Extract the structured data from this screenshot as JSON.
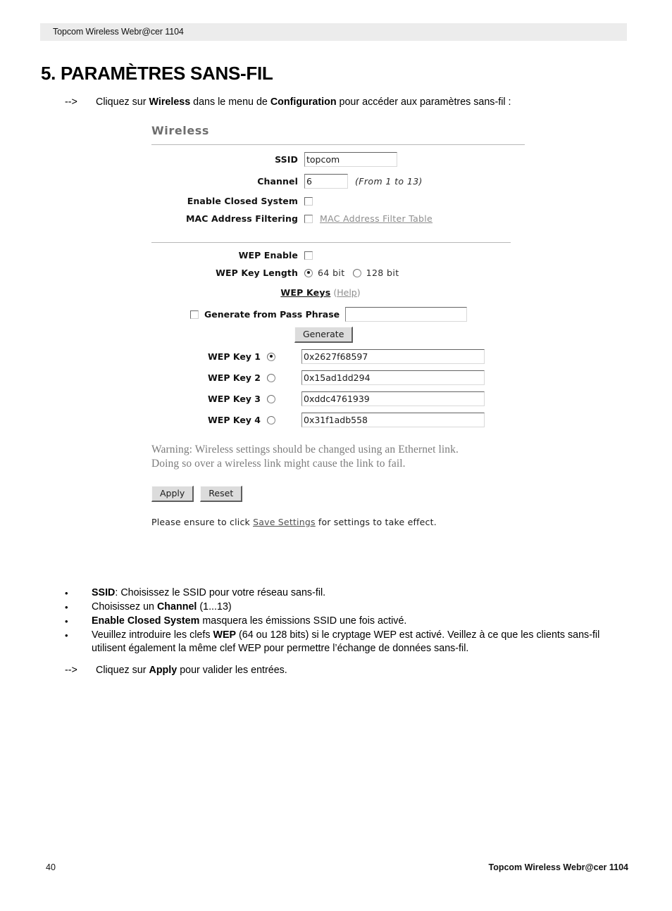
{
  "page": {
    "running_header": "Topcom Wireless Webr@cer 1104",
    "chapter_title": "5. PARAMÈTRES SANS-FIL",
    "footer_page_number": "40",
    "footer_right": "Topcom Wireless Webr@cer 1104"
  },
  "intro": {
    "arrow": "-->",
    "part1": "Cliquez sur ",
    "bold1": "Wireless",
    "part2": " dans le menu de ",
    "bold2": "Configuration",
    "part3": " pour accéder aux paramètres sans-fil :"
  },
  "router_ui": {
    "panel_title": "Wireless",
    "ssid": {
      "label": "SSID",
      "value": "topcom"
    },
    "channel": {
      "label": "Channel",
      "value": "6",
      "hint": "(From 1 to 13)"
    },
    "closed_system": {
      "label": "Enable Closed System",
      "checked": false
    },
    "mac_filtering": {
      "label": "MAC Address Filtering",
      "checked": false,
      "link": "MAC Address Filter Table"
    },
    "wep_enable": {
      "label": "WEP Enable",
      "checked": false
    },
    "wep_key_length": {
      "label": "WEP Key Length",
      "options": [
        {
          "label": "64 bit",
          "selected": true
        },
        {
          "label": "128 bit",
          "selected": false
        }
      ]
    },
    "wep_keys_heading": {
      "title": "WEP Keys",
      "help_open": "(",
      "help": "Help",
      "help_close": ")"
    },
    "pass_phrase": {
      "label": "Generate from Pass Phrase",
      "checked": false,
      "value": "",
      "placeholder": ""
    },
    "generate_button": "Generate",
    "wep_keys": [
      {
        "label": "WEP Key 1",
        "value": "0x2627f68597",
        "selected": true
      },
      {
        "label": "WEP Key 2",
        "value": "0x15ad1dd294",
        "selected": false
      },
      {
        "label": "WEP Key 3",
        "value": "0xddc4761939",
        "selected": false
      },
      {
        "label": "WEP Key 4",
        "value": "0x31f1adb558",
        "selected": false
      }
    ],
    "warning_line1": "Warning: Wireless settings should be changed using an Ethernet link.",
    "warning_line2": "Doing so over a wireless link might cause the link to fail.",
    "apply_button": "Apply",
    "reset_button": "Reset",
    "save_note": {
      "before": "Please ensure to click ",
      "link": "Save Settings",
      "after": " for settings to take effect."
    }
  },
  "bullets": [
    {
      "marker": "•",
      "segments": [
        {
          "text": "SSID",
          "bold": true
        },
        {
          "text": ": Choisissez le SSID pour votre réseau sans-fil.",
          "bold": false
        }
      ]
    },
    {
      "marker": "•",
      "segments": [
        {
          "text": "Choisissez un ",
          "bold": false
        },
        {
          "text": "Channel",
          "bold": true
        },
        {
          "text": " (1...13)",
          "bold": false
        }
      ]
    },
    {
      "marker": "•",
      "segments": [
        {
          "text": "Enable Closed System",
          "bold": true
        },
        {
          "text": " masquera les émissions SSID une fois activé.",
          "bold": false
        }
      ]
    },
    {
      "marker": "•",
      "segments": [
        {
          "text": "Veuillez introduire les clefs ",
          "bold": false
        },
        {
          "text": "WEP",
          "bold": true
        },
        {
          "text": " (64 ou 128 bits) si le cryptage WEP est activé.  Veillez à ce que les clients sans-fil utilisent également la même clef WEP pour permettre l’échange de données sans-fil.",
          "bold": false
        }
      ]
    }
  ],
  "apply_instruction": {
    "arrow": "-->",
    "part1": "Cliquez sur ",
    "bold1": "Apply",
    "part2": " pour valider les entrées."
  },
  "colors": {
    "header_band": "#ececec",
    "panel_title": "#6e6e6e",
    "rule": "#b7b7b7",
    "link_gray": "#8d8d8d",
    "warning_text": "#7c7c7c",
    "button_face": "#dcdcdc"
  }
}
